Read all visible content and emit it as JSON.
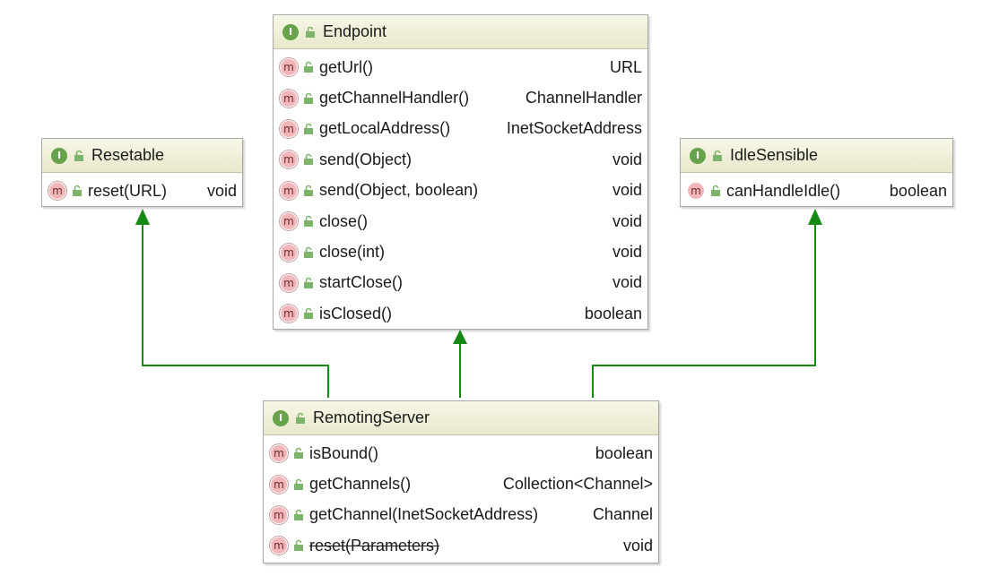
{
  "colors": {
    "interface_badge": "#66a34b",
    "method_badge": "#f2b5b8",
    "header_bg": "#ecebd2",
    "arrow": "#148a14"
  },
  "icons": {
    "interface": "interface-i-icon",
    "method": "method-m-icon",
    "visibility": "public-lock-icon"
  },
  "badges": {
    "interface": "I",
    "method": "m"
  },
  "endpoint": {
    "title": "Endpoint",
    "methods": [
      {
        "name": "getUrl()",
        "type": "URL"
      },
      {
        "name": "getChannelHandler()",
        "type": "ChannelHandler"
      },
      {
        "name": "getLocalAddress()",
        "type": "InetSocketAddress"
      },
      {
        "name": "send(Object)",
        "type": "void"
      },
      {
        "name": "send(Object, boolean)",
        "type": "void"
      },
      {
        "name": "close()",
        "type": "void"
      },
      {
        "name": "close(int)",
        "type": "void"
      },
      {
        "name": "startClose()",
        "type": "void"
      },
      {
        "name": "isClosed()",
        "type": "boolean"
      }
    ]
  },
  "resetable": {
    "title": "Resetable",
    "methods": [
      {
        "name": "reset(URL)",
        "type": "void"
      }
    ]
  },
  "idle_sensible": {
    "title": "IdleSensible",
    "methods": [
      {
        "name": "canHandleIdle()",
        "type": "boolean"
      }
    ]
  },
  "remoting_server": {
    "title": "RemotingServer",
    "methods": [
      {
        "name": "isBound()",
        "type": "boolean"
      },
      {
        "name": "getChannels()",
        "type": "Collection<Channel>"
      },
      {
        "name": "getChannel(InetSocketAddress)",
        "type": "Channel"
      },
      {
        "name": "reset(Parameters)",
        "type": "void",
        "deprecated": true
      }
    ]
  },
  "relations": [
    {
      "from": "RemotingServer",
      "to": "Endpoint",
      "kind": "extends"
    },
    {
      "from": "RemotingServer",
      "to": "Resetable",
      "kind": "extends"
    },
    {
      "from": "RemotingServer",
      "to": "IdleSensible",
      "kind": "extends"
    }
  ]
}
